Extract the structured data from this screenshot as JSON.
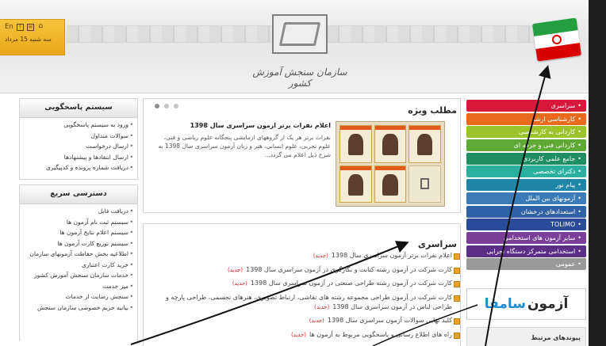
{
  "header": {
    "lang_label": "En",
    "date": "سه شنبه 15 مرداد",
    "org_name": "سازمان سنجش آموزش کشور",
    "icons": [
      "help-icon",
      "mail-icon",
      "home-icon"
    ]
  },
  "menu": {
    "items": [
      {
        "label": "سراسری",
        "color": "#d6193a"
      },
      {
        "label": "کارشناسی ارشد",
        "color": "#e9691d"
      },
      {
        "label": "کاردانی به کارشناسی",
        "color": "#9bc32b"
      },
      {
        "label": "کاردانی فنی و حرفه ای",
        "color": "#5faa37"
      },
      {
        "label": "جامع علمی کاربردی",
        "color": "#1f8f5f"
      },
      {
        "label": "دکترای تخصصی",
        "color": "#2bb0a0"
      },
      {
        "label": "پیام نور",
        "color": "#1f86a8"
      },
      {
        "label": "آزمونهای بین الملل",
        "color": "#3b7bb8"
      },
      {
        "label": "استعدادهای درخشان",
        "color": "#2f62a6"
      },
      {
        "label": "TOLIMO",
        "color": "#2a4a9a"
      },
      {
        "label": "سایر آزمون های استخدامی",
        "color": "#7b3f9a"
      },
      {
        "label": "استخدامی متمرکز دستگاه اجرایی",
        "color": "#5b2f85"
      },
      {
        "label": "عمومی",
        "color": "#9a9a9a"
      }
    ],
    "banner_part1": "آزمون",
    "banner_part2": "سامفا",
    "related_links": "پیوندهای مرتبط"
  },
  "featured": {
    "header": "مطلب ویژه",
    "title": "اعلام نفرات برتر ازمون سراسری سال 1398",
    "body": "نفرات برتر هر یک از گروههای ازمایشی پنجگانه علوم ریاضی و فنی، علوم تجربی، علوم انسانی، هنر و زبان آزمون سراسری سال 1398 به شرح ذیل اعلام می گردد..."
  },
  "national": {
    "header": "سراسری",
    "items": [
      {
        "text": "اعلام نفرات برتر آزمون سراسری سال 1398",
        "badge": "(جدید)"
      },
      {
        "text": "کارت شرکت در آزمون رشته کتابت و نگارگری در آزمون سراسری سال 1398",
        "badge": "(جدید)"
      },
      {
        "text": "کارت شرکت در آزمون رشته طراحی صنعتی در آزمون سراسری سال 1398",
        "badge": "(جدید)"
      },
      {
        "text": "کارت شرکت در آزمون طراحی مجموعه رشته های نقاشی، ارتباط تصویری، هنرهای تجسمی، طراحی پارچه و طراحی لباس در آزمون سراسری سال 1398",
        "badge": "(جدید)"
      },
      {
        "text": "کلید نهایی سوالات آزمون سراسری سال 1398",
        "badge": "(جدید)"
      },
      {
        "text": "راه های اطلاع رسانی و پاسخگویی مربوط به آزمون ها",
        "badge": "(جدید)"
      }
    ]
  },
  "left": {
    "box1_title": "سیستم پاسخگویی",
    "box1_items": [
      "ورود به سیستم پاسخگویی",
      "سوالات متداول",
      "ارسال درخواست",
      "ارسال انتقادها و پیشنهادها",
      "دریافت شماره پرونده و کدپیگیری"
    ],
    "box2_title": "دسترسی سریع",
    "box2_items": [
      "دریافت فایل",
      "سیستم ثبت نام آزمون ها",
      "سیستم اعلام نتایج آزمون ها",
      "سیستم توزیع کارت آزمون ها",
      "اطلاعیه بخش حفاظت آزمونهای سازمان",
      "خرید کارت اعتباری",
      "خدمات سازمان سنجش آموزش کشور",
      "میز خدمت",
      "سنجش رضایت از خدمات",
      "بیانیه حریم خصوصی سازمان سنجش"
    ]
  }
}
